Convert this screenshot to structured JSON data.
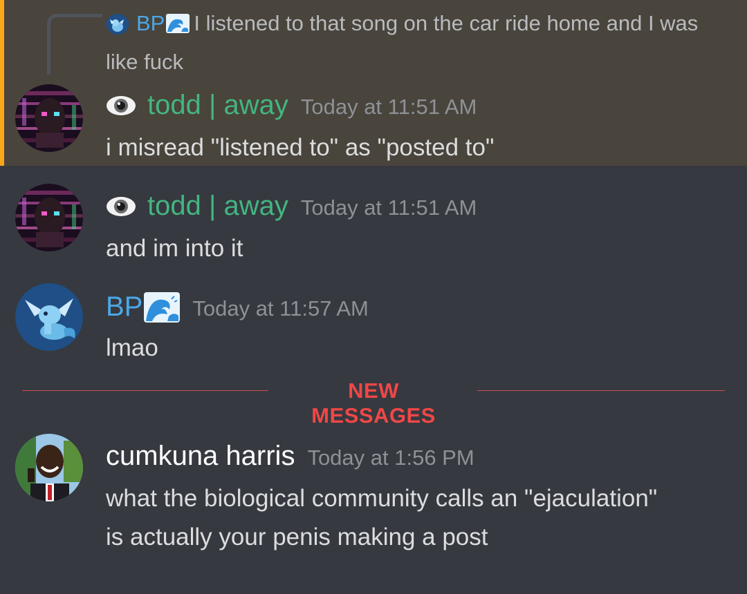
{
  "reply_preview": {
    "author": "BP",
    "author_color": "#4ba8e8",
    "author_badge_icon": "water-wave-icon",
    "text": "I listened to that song on the car ride home and I was like fuck"
  },
  "messages": [
    {
      "author": "todd | away",
      "author_color": "#43b581",
      "prefix_icon": "eye-icon",
      "timestamp": "Today at 11:51 AM",
      "text": "i misread \"listened to\" as \"posted to\"",
      "highlighted": true
    },
    {
      "author": "todd | away",
      "author_color": "#43b581",
      "prefix_icon": "eye-icon",
      "timestamp": "Today at 11:51 AM",
      "text": "and im into it"
    },
    {
      "author": "BP",
      "author_color": "#4ba8e8",
      "suffix_icon": "water-wave-icon",
      "timestamp": "Today at 11:57 AM",
      "text": "lmao"
    },
    {
      "author": "cumkuna harris",
      "author_color": "#ffffff",
      "timestamp": "Today at 1:56 PM",
      "text_lines": [
        "what the biological community calls an \"ejaculation\"",
        "is actually your penis making a post"
      ]
    }
  ],
  "divider": {
    "label": "NEW MESSAGES",
    "color": "#f04747"
  },
  "theme": {
    "background": "#36393f",
    "mention_background": "#49443c",
    "mention_bar": "#faa61a"
  }
}
